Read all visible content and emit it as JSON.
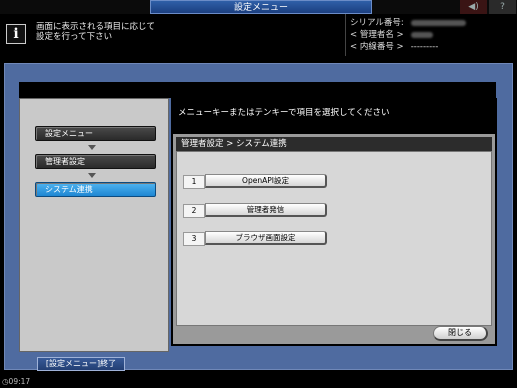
{
  "topbar": {
    "title": "設定メニュー",
    "icon_left": "◀)",
    "icon_right": "?"
  },
  "message": {
    "line1": "画面に表示される項目に応じて",
    "line2": "設定を行って下さい"
  },
  "meta": {
    "serial_label": "シリアル番号:",
    "admin_label": "< 管理者名 >",
    "ext_label": "< 内線番号 >",
    "ext_value": "---------"
  },
  "instruction": "メニューキーまたはテンキーで項目を選択してください",
  "breadcrumb": {
    "items": [
      {
        "label": "設定メニュー"
      },
      {
        "label": "管理者設定"
      },
      {
        "label": "システム連携"
      }
    ]
  },
  "panel": {
    "header": "管理者設定 > システム連携",
    "menu": [
      {
        "num": "1",
        "label": "OpenAPI設定"
      },
      {
        "num": "2",
        "label": "管理者発信"
      },
      {
        "num": "3",
        "label": "ブラウザ画面設定"
      }
    ],
    "close_label": "閉じる"
  },
  "footer": {
    "end_label": "[設定メニュー]終了",
    "clock": "09:17"
  }
}
